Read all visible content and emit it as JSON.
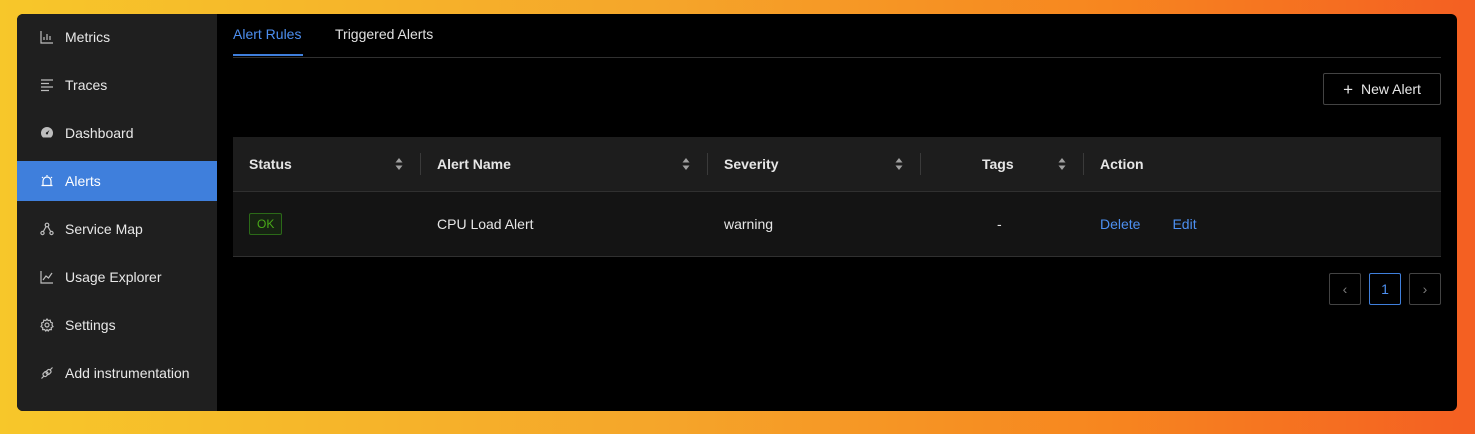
{
  "sidebar": {
    "items": [
      {
        "label": "Metrics",
        "icon": "bar-chart-icon"
      },
      {
        "label": "Traces",
        "icon": "align-left-icon"
      },
      {
        "label": "Dashboard",
        "icon": "dashboard-icon"
      },
      {
        "label": "Alerts",
        "icon": "alert-icon",
        "active": true
      },
      {
        "label": "Service Map",
        "icon": "deployment-unit-icon"
      },
      {
        "label": "Usage Explorer",
        "icon": "line-chart-icon"
      },
      {
        "label": "Settings",
        "icon": "gear-icon"
      },
      {
        "label": "Add instrumentation",
        "icon": "api-icon"
      }
    ]
  },
  "tabs": [
    {
      "label": "Alert Rules",
      "active": true
    },
    {
      "label": "Triggered Alerts"
    }
  ],
  "toolbar": {
    "new_alert_label": "New Alert"
  },
  "table": {
    "columns": [
      "Status",
      "Alert Name",
      "Severity",
      "Tags",
      "Action"
    ],
    "rows": [
      {
        "status": "OK",
        "name": "CPU Load Alert",
        "severity": "warning",
        "tags": "-",
        "actions": [
          "Delete",
          "Edit"
        ]
      }
    ]
  },
  "pagination": {
    "prev": "‹",
    "current": "1",
    "next": "›"
  },
  "colors": {
    "accent": "#3f7fdc",
    "link": "#4d8ff0",
    "ok_green": "#49aa19"
  }
}
